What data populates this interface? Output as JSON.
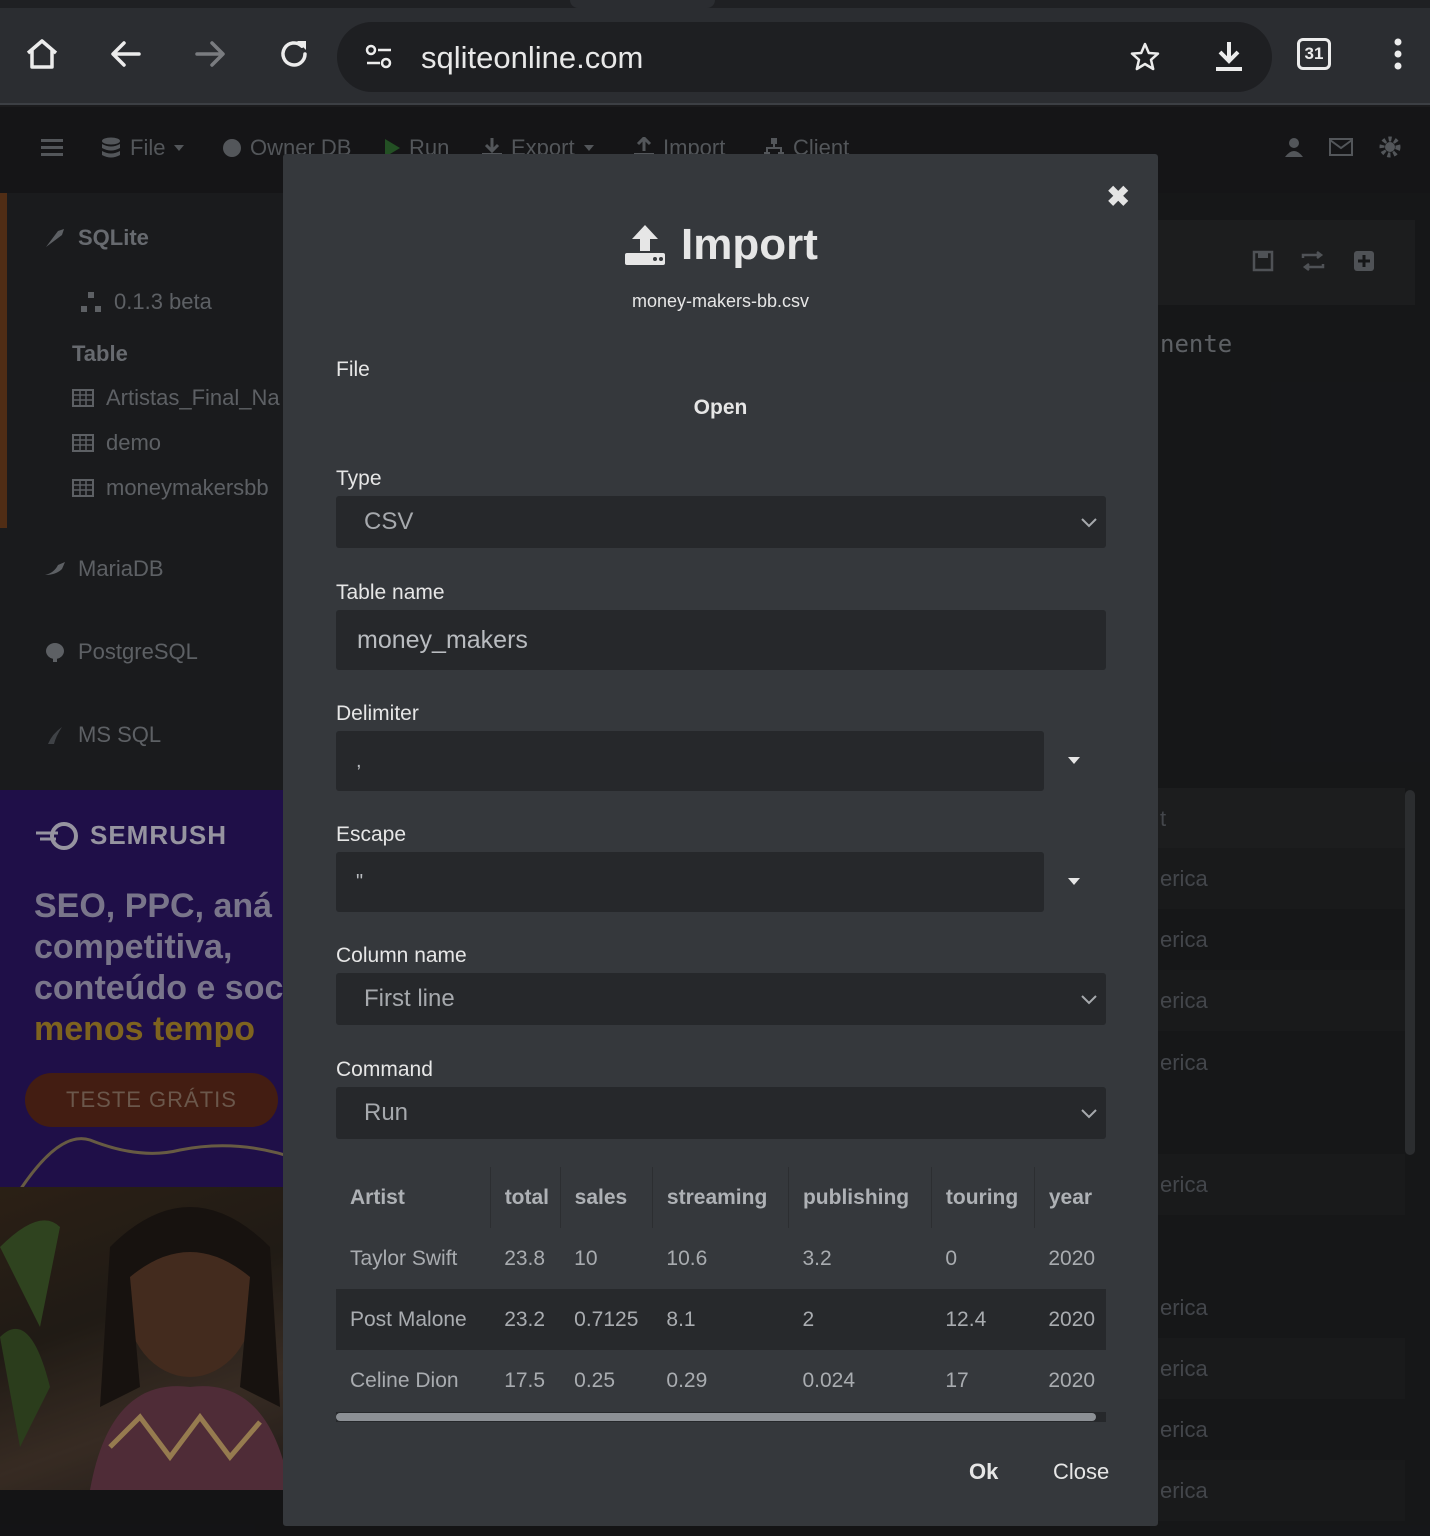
{
  "browser": {
    "url": "sqliteonline.com",
    "tab_count": "31"
  },
  "toolbar": {
    "file": "File",
    "owner_db": "Owner DB",
    "run": "Run",
    "export": "Export",
    "import": "Import",
    "client": "Client"
  },
  "sidebar": {
    "sqlite": "SQLite",
    "version": "0.1.3 beta",
    "table_header": "Table",
    "tables": [
      "Artistas_Final_Na",
      "demo",
      "moneymakersbb"
    ],
    "mariadb": "MariaDB",
    "postgresql": "PostgreSQL",
    "mssql": "MS SQL"
  },
  "ad": {
    "brand": "SEMRUSH",
    "line1": "SEO, PPC, aná",
    "line2": "competitiva,",
    "line3": "conteúdo e soc",
    "line4": "menos tempo",
    "cta": "TESTE GRÁTIS"
  },
  "background": {
    "code_fragment": "nente",
    "header_fragment": "t",
    "row_fragment": "erica"
  },
  "modal": {
    "title": "Import",
    "filename": "money-makers-bb.csv",
    "file_label": "File",
    "open_button": "Open",
    "type_label": "Type",
    "type_value": "CSV",
    "table_name_label": "Table name",
    "table_name_value": "money_makers",
    "delimiter_label": "Delimiter",
    "delimiter_value": ",",
    "escape_label": "Escape",
    "escape_value": "\"",
    "column_name_label": "Column name",
    "column_name_value": "First line",
    "command_label": "Command",
    "command_value": "Run",
    "ok_button": "Ok",
    "close_button": "Close"
  },
  "preview": {
    "columns": [
      "Artist",
      "total",
      "sales",
      "streaming",
      "publishing",
      "touring",
      "year"
    ],
    "rows": [
      [
        "Taylor Swift",
        "23.8",
        "10",
        "10.6",
        "3.2",
        "0",
        "2020"
      ],
      [
        "Post Malone",
        "23.2",
        "0.7125",
        "8.1",
        "2",
        "12.4",
        "2020"
      ],
      [
        "Celine Dion",
        "17.5",
        "0.25",
        "0.29",
        "0.024",
        "17",
        "2020"
      ]
    ]
  }
}
